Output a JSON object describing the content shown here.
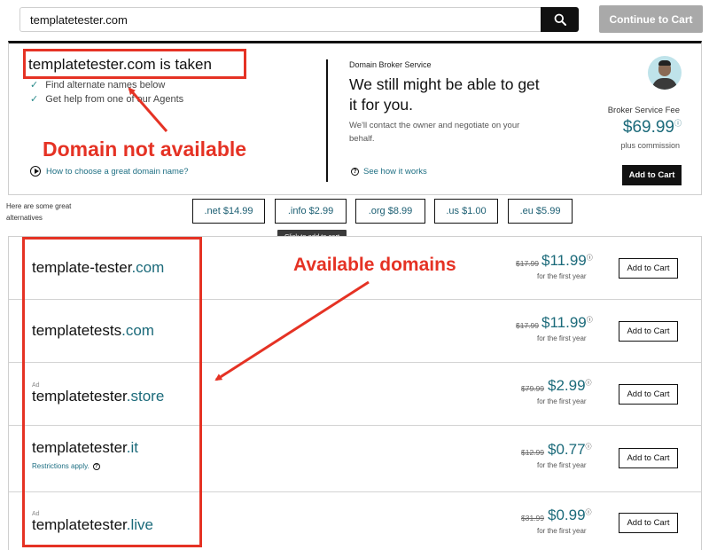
{
  "search": {
    "value": "templatetester.com"
  },
  "header": {
    "continue_label": "Continue to Cart"
  },
  "taken": {
    "title": "templatetester.com is taken",
    "suggestions": [
      "Find alternate names below",
      "Get help from one of our Agents"
    ],
    "howto_link": "How to choose a great domain name?"
  },
  "broker": {
    "label": "Domain Broker Service",
    "headline": "We still might be able to get it for you.",
    "description": "We'll contact the owner and negotiate on your behalf.",
    "see_how": "See how it works",
    "fee_label": "Broker Service Fee",
    "fee_price": "$69.99",
    "fee_sub": "plus commission",
    "cart_label": "Add to Cart"
  },
  "alternatives": {
    "label": "Here are some great alternatives",
    "tlds": [
      ".net $14.99",
      ".info $2.99",
      ".org $8.99",
      ".us $1.00",
      ".eu $5.99"
    ],
    "tooltip": "Click to add to cart"
  },
  "results": [
    {
      "ad": "",
      "name": "template-tester",
      "tld": ".com",
      "note": "",
      "old_price": "$17.99",
      "price": "$11.99",
      "period": "for the first year",
      "cart": "Add to Cart"
    },
    {
      "ad": "",
      "name": "templatetests",
      "tld": ".com",
      "note": "",
      "old_price": "$17.99",
      "price": "$11.99",
      "period": "for the first year",
      "cart": "Add to Cart"
    },
    {
      "ad": "Ad",
      "name": "templatetester",
      "tld": ".store",
      "note": "",
      "old_price": "$79.99",
      "price": "$2.99",
      "period": "for the first year",
      "cart": "Add to Cart"
    },
    {
      "ad": "",
      "name": "templatetester",
      "tld": ".it",
      "note": "Restrictions apply.",
      "old_price": "$12.99",
      "price": "$0.77",
      "period": "for the first year",
      "cart": "Add to Cart"
    },
    {
      "ad": "Ad",
      "name": "templatetester",
      "tld": ".live",
      "note": "",
      "old_price": "$31.99",
      "price": "$0.99",
      "period": "for the first year",
      "cart": "Add to Cart"
    }
  ],
  "annotations": {
    "not_available": "Domain not available",
    "available": "Available domains",
    "color": "#e53224"
  },
  "colors": {
    "accent": "#1b6a7a",
    "dark": "#111111",
    "annotation": "#e53224"
  }
}
